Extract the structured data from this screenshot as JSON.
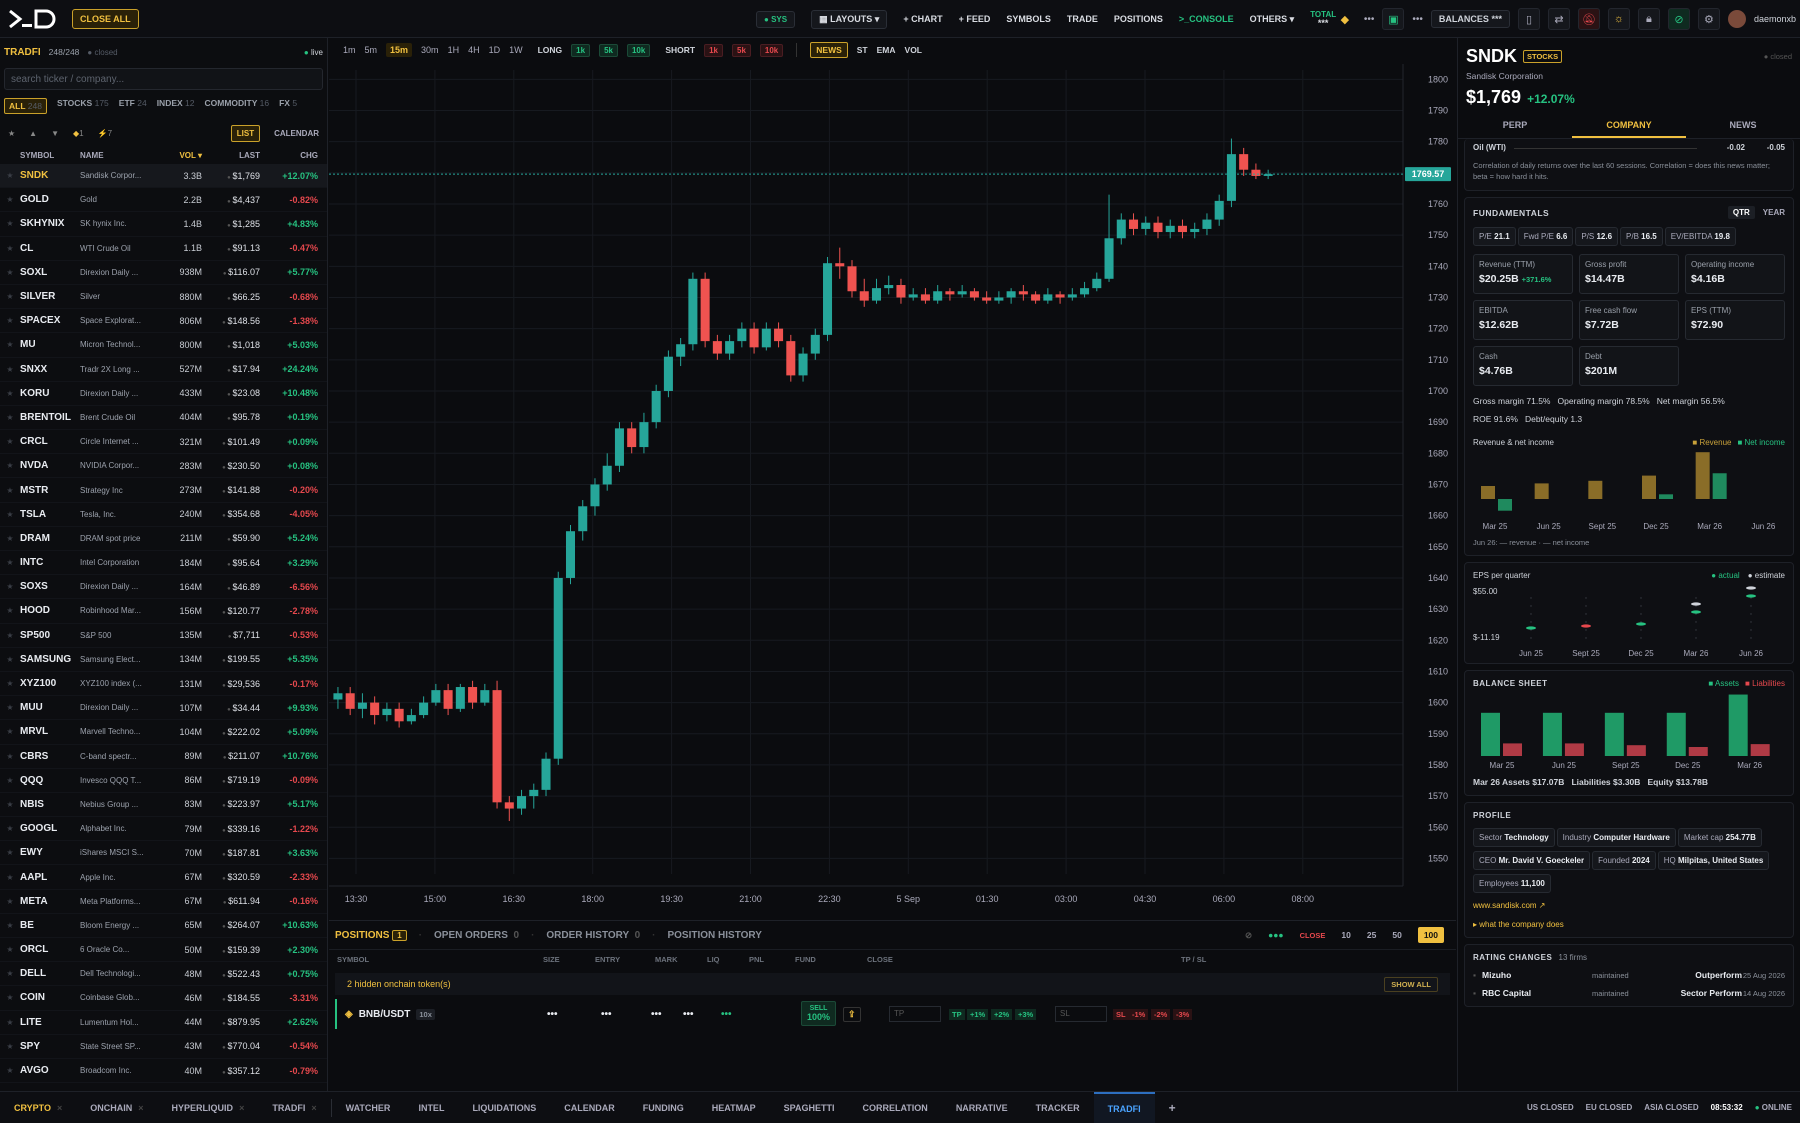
{
  "topbar": {
    "close_all": "CLOSE ALL",
    "sys": "SYS",
    "nav": [
      "LAYOUTS",
      "+ CHART",
      "+ FEED",
      "SYMBOLS",
      "TRADE",
      "POSITIONS",
      ">_CONSOLE",
      "OTHERS"
    ],
    "total_label": "TOTAL",
    "total_value": "***",
    "balances_label": "BALANCES",
    "balances_value": "***",
    "username": "daemonxb"
  },
  "watchlist": {
    "title": "TRADFI",
    "count": "248/248",
    "status_closed": "closed",
    "live": "live",
    "search_placeholder": "search ticker / company...",
    "categories": [
      {
        "label": "ALL",
        "n": "248"
      },
      {
        "label": "STOCKS",
        "n": "175"
      },
      {
        "label": "ETF",
        "n": "24"
      },
      {
        "label": "INDEX",
        "n": "12"
      },
      {
        "label": "COMMODITY",
        "n": "16"
      },
      {
        "label": "FX",
        "n": "5"
      }
    ],
    "filter_badges": [
      "1",
      "7"
    ],
    "list_btn": "LIST",
    "calendar_btn": "CALENDAR",
    "headers": {
      "symbol": "SYMBOL",
      "name": "NAME",
      "vol": "VOL",
      "last": "LAST",
      "chg": "CHG"
    },
    "rows": [
      [
        "SNDK",
        "Sandisk Corpor...",
        "3.3B",
        "$1,769",
        "+12.07%"
      ],
      [
        "GOLD",
        "Gold",
        "2.2B",
        "$4,437",
        "-0.82%"
      ],
      [
        "SKHYNIX",
        "SK hynix Inc.",
        "1.4B",
        "$1,285",
        "+4.83%"
      ],
      [
        "CL",
        "WTI Crude Oil",
        "1.1B",
        "$91.13",
        "-0.47%"
      ],
      [
        "SOXL",
        "Direxion Daily ...",
        "938M",
        "$116.07",
        "+5.77%"
      ],
      [
        "SILVER",
        "Silver",
        "880M",
        "$66.25",
        "-0.68%"
      ],
      [
        "SPACEX",
        "Space Explorat...",
        "806M",
        "$148.56",
        "-1.38%"
      ],
      [
        "MU",
        "Micron Technol...",
        "800M",
        "$1,018",
        "+5.03%"
      ],
      [
        "SNXX",
        "Tradr 2X Long ...",
        "527M",
        "$17.94",
        "+24.24%"
      ],
      [
        "KORU",
        "Direxion Daily ...",
        "433M",
        "$23.08",
        "+10.48%"
      ],
      [
        "BRENTOIL",
        "Brent Crude Oil",
        "404M",
        "$95.78",
        "+0.19%"
      ],
      [
        "CRCL",
        "Circle Internet ...",
        "321M",
        "$101.49",
        "+0.09%"
      ],
      [
        "NVDA",
        "NVIDIA Corpor...",
        "283M",
        "$230.50",
        "+0.08%"
      ],
      [
        "MSTR",
        "Strategy Inc",
        "273M",
        "$141.88",
        "-0.20%"
      ],
      [
        "TSLA",
        "Tesla, Inc.",
        "240M",
        "$354.68",
        "-4.05%"
      ],
      [
        "DRAM",
        "DRAM spot price",
        "211M",
        "$59.90",
        "+5.24%"
      ],
      [
        "INTC",
        "Intel Corporation",
        "184M",
        "$95.64",
        "+3.29%"
      ],
      [
        "SOXS",
        "Direxion Daily ...",
        "164M",
        "$46.89",
        "-6.56%"
      ],
      [
        "HOOD",
        "Robinhood Mar...",
        "156M",
        "$120.77",
        "-2.78%"
      ],
      [
        "SP500",
        "S&P 500",
        "135M",
        "$7,711",
        "-0.53%"
      ],
      [
        "SAMSUNG",
        "Samsung Elect...",
        "134M",
        "$199.55",
        "+5.35%"
      ],
      [
        "XYZ100",
        "XYZ100 index (...",
        "131M",
        "$29,536",
        "-0.17%"
      ],
      [
        "MUU",
        "Direxion Daily ...",
        "107M",
        "$34.44",
        "+9.93%"
      ],
      [
        "MRVL",
        "Marvell Techno...",
        "104M",
        "$222.02",
        "+5.09%"
      ],
      [
        "CBRS",
        "C-band spectr...",
        "89M",
        "$211.07",
        "+10.76%"
      ],
      [
        "QQQ",
        "Invesco QQQ T...",
        "86M",
        "$719.19",
        "-0.09%"
      ],
      [
        "NBIS",
        "Nebius Group ...",
        "83M",
        "$223.97",
        "+5.17%"
      ],
      [
        "GOOGL",
        "Alphabet Inc.",
        "79M",
        "$339.16",
        "-1.22%"
      ],
      [
        "EWY",
        "iShares MSCI S...",
        "70M",
        "$187.81",
        "+3.63%"
      ],
      [
        "AAPL",
        "Apple Inc.",
        "67M",
        "$320.59",
        "-2.33%"
      ],
      [
        "META",
        "Meta Platforms...",
        "67M",
        "$611.94",
        "-0.16%"
      ],
      [
        "BE",
        "Bloom Energy ...",
        "65M",
        "$264.07",
        "+10.63%"
      ],
      [
        "ORCL",
        "6 Oracle Co...",
        "50M",
        "$159.39",
        "+2.30%"
      ],
      [
        "DELL",
        "Dell Technologi...",
        "48M",
        "$522.43",
        "+0.75%"
      ],
      [
        "COIN",
        "Coinbase Glob...",
        "46M",
        "$184.55",
        "-3.31%"
      ],
      [
        "LITE",
        "Lumentum Hol...",
        "44M",
        "$879.95",
        "+2.62%"
      ],
      [
        "SPY",
        "State Street SP...",
        "43M",
        "$770.04",
        "-0.54%"
      ],
      [
        "AVGO",
        "Broadcom Inc.",
        "40M",
        "$357.12",
        "-0.79%"
      ]
    ]
  },
  "chart_toolbar": {
    "timeframes": [
      "1m",
      "5m",
      "15m",
      "30m",
      "1H",
      "4H",
      "1D",
      "1W"
    ],
    "active_tf": "15m",
    "long_label": "LONG",
    "long_sizes": [
      "1k",
      "5k",
      "10k"
    ],
    "short_label": "SHORT",
    "short_sizes": [
      "1k",
      "5k",
      "10k"
    ],
    "indicators": [
      "NEWS",
      "ST",
      "EMA",
      "VOL"
    ]
  },
  "chart_data": {
    "type": "candlestick",
    "y_ticks": [
      1800,
      1790,
      1780,
      1770,
      1760,
      1750,
      1740,
      1730,
      1720,
      1710,
      1700,
      1690,
      1680,
      1670,
      1660,
      1650,
      1640,
      1630,
      1620,
      1610,
      1600,
      1590,
      1580,
      1570,
      1560,
      1550
    ],
    "ylim": [
      1545,
      1803
    ],
    "x_ticks": [
      "13:30",
      "15:00",
      "16:30",
      "18:00",
      "19:30",
      "21:00",
      "22:30",
      "5 Sep",
      "01:30",
      "03:00",
      "04:30",
      "06:00",
      "08:00"
    ],
    "last_price": "1769.57",
    "last_value": 1769.57,
    "candles": [
      [
        1601,
        1603,
        1598,
        1605
      ],
      [
        1603,
        1598,
        1596,
        1605
      ],
      [
        1598,
        1600,
        1595,
        1603
      ],
      [
        1600,
        1596,
        1593,
        1602
      ],
      [
        1596,
        1598,
        1594,
        1600
      ],
      [
        1598,
        1594,
        1592,
        1600
      ],
      [
        1594,
        1596,
        1593,
        1598
      ],
      [
        1596,
        1600,
        1595,
        1602
      ],
      [
        1600,
        1604,
        1599,
        1606
      ],
      [
        1604,
        1598,
        1596,
        1606
      ],
      [
        1598,
        1605,
        1597,
        1606
      ],
      [
        1605,
        1600,
        1598,
        1607
      ],
      [
        1600,
        1604,
        1599,
        1606
      ],
      [
        1604,
        1568,
        1566,
        1607
      ],
      [
        1568,
        1566,
        1562,
        1570
      ],
      [
        1566,
        1570,
        1564,
        1572
      ],
      [
        1570,
        1572,
        1566,
        1574
      ],
      [
        1572,
        1582,
        1570,
        1584
      ],
      [
        1582,
        1640,
        1580,
        1642
      ],
      [
        1640,
        1655,
        1638,
        1657
      ],
      [
        1655,
        1663,
        1652,
        1665
      ],
      [
        1663,
        1670,
        1660,
        1672
      ],
      [
        1670,
        1676,
        1668,
        1680
      ],
      [
        1676,
        1688,
        1674,
        1690
      ],
      [
        1688,
        1682,
        1680,
        1690
      ],
      [
        1682,
        1690,
        1680,
        1693
      ],
      [
        1690,
        1700,
        1688,
        1702
      ],
      [
        1700,
        1711,
        1698,
        1713
      ],
      [
        1711,
        1715,
        1708,
        1717
      ],
      [
        1715,
        1736,
        1713,
        1738
      ],
      [
        1736,
        1716,
        1714,
        1738
      ],
      [
        1716,
        1712,
        1710,
        1718
      ],
      [
        1712,
        1716,
        1710,
        1718
      ],
      [
        1716,
        1720,
        1714,
        1722
      ],
      [
        1720,
        1714,
        1712,
        1722
      ],
      [
        1714,
        1720,
        1713,
        1722
      ],
      [
        1720,
        1716,
        1714,
        1722
      ],
      [
        1716,
        1705,
        1703,
        1718
      ],
      [
        1705,
        1712,
        1703,
        1714
      ],
      [
        1712,
        1718,
        1710,
        1720
      ],
      [
        1718,
        1741,
        1716,
        1743
      ],
      [
        1741,
        1740,
        1736,
        1746
      ],
      [
        1740,
        1732,
        1730,
        1742
      ],
      [
        1732,
        1729,
        1727,
        1736
      ],
      [
        1729,
        1733,
        1728,
        1736
      ],
      [
        1733,
        1734,
        1731,
        1737
      ],
      [
        1734,
        1730,
        1728,
        1736
      ],
      [
        1730,
        1731,
        1729,
        1733
      ],
      [
        1731,
        1729,
        1728,
        1733
      ],
      [
        1729,
        1732,
        1728,
        1734
      ],
      [
        1732,
        1731,
        1729,
        1733
      ],
      [
        1731,
        1732,
        1730,
        1734
      ],
      [
        1732,
        1730,
        1729,
        1733
      ],
      [
        1730,
        1729,
        1728,
        1732
      ],
      [
        1729,
        1730,
        1728,
        1732
      ],
      [
        1730,
        1732,
        1728,
        1733
      ],
      [
        1732,
        1731,
        1729,
        1734
      ],
      [
        1731,
        1729,
        1728,
        1732
      ],
      [
        1729,
        1731,
        1728,
        1733
      ],
      [
        1731,
        1730,
        1728,
        1732
      ],
      [
        1730,
        1731,
        1729,
        1733
      ],
      [
        1731,
        1733,
        1730,
        1735
      ],
      [
        1733,
        1736,
        1732,
        1738
      ],
      [
        1736,
        1749,
        1735,
        1763
      ],
      [
        1749,
        1755,
        1747,
        1757
      ],
      [
        1755,
        1752,
        1750,
        1757
      ],
      [
        1752,
        1754,
        1750,
        1756
      ],
      [
        1754,
        1751,
        1749,
        1756
      ],
      [
        1751,
        1753,
        1749,
        1755
      ],
      [
        1753,
        1751,
        1749,
        1755
      ],
      [
        1751,
        1752,
        1749,
        1754
      ],
      [
        1752,
        1755,
        1750,
        1757
      ],
      [
        1755,
        1761,
        1753,
        1763
      ],
      [
        1761,
        1776,
        1759,
        1781
      ],
      [
        1776,
        1771,
        1769,
        1778
      ],
      [
        1771,
        1769,
        1768,
        1773
      ],
      [
        1769,
        1769.57,
        1768,
        1771
      ]
    ]
  },
  "positions": {
    "tabs": [
      "POSITIONS",
      "OPEN ORDERS",
      "ORDER HISTORY",
      "POSITION HISTORY"
    ],
    "counts": [
      "1",
      "0",
      "0"
    ],
    "close_label": "CLOSE",
    "sizes": [
      "10",
      "25",
      "50",
      "100"
    ],
    "columns": [
      "SYMBOL",
      "SIZE",
      "ENTRY",
      "MARK",
      "LIQ",
      "PNL",
      "FUND",
      "CLOSE",
      "TP / SL"
    ],
    "hidden_note": "2 hidden onchain token(s)",
    "show_all": "SHOW ALL",
    "row": {
      "symbol": "BNB/USDT",
      "leverage": "10x",
      "sell": "SELL",
      "sell_pct": "100%",
      "tp_placeholder": "TP",
      "sl_placeholder": "SL",
      "tp_label": "TP",
      "sl_label": "SL",
      "tp_opts": [
        "+1%",
        "+2%",
        "+3%"
      ],
      "sl_opts": [
        "-1%",
        "-2%",
        "-3%"
      ]
    }
  },
  "detail": {
    "ticker": "SNDK",
    "tag": "STOCKS",
    "closed": "closed",
    "company": "Sandisk Corporation",
    "price": "$1,769",
    "change": "+12.07%",
    "tabs": [
      "PERP",
      "COMPANY",
      "NEWS"
    ],
    "corr_label": "Oil (WTI)",
    "corr_v1": "-0.02",
    "corr_v2": "-0.05",
    "corr_note": "Correlation of daily returns over the last 60 sessions. Correlation = does this news matter; beta = how hard it hits.",
    "fund_title": "FUNDAMENTALS",
    "qtr": "QTR",
    "year": "YEAR",
    "ratios": [
      [
        "P/E",
        "21.1"
      ],
      [
        "Fwd P/E",
        "6.6"
      ],
      [
        "P/S",
        "12.6"
      ],
      [
        "P/B",
        "16.5"
      ],
      [
        "EV/EBITDA",
        "19.8"
      ]
    ],
    "boxes": [
      [
        "Revenue (TTM)",
        "$20.25B",
        "+371.6%"
      ],
      [
        "Gross profit",
        "$14.47B",
        ""
      ],
      [
        "Operating income",
        "$4.16B",
        ""
      ],
      [
        "EBITDA",
        "$12.62B",
        ""
      ],
      [
        "Free cash flow",
        "$7.72B",
        ""
      ],
      [
        "EPS (TTM)",
        "$72.90",
        ""
      ],
      [
        "Cash",
        "$4.76B",
        ""
      ],
      [
        "Debt",
        "$201M",
        ""
      ]
    ],
    "margins": "Gross margin 71.5%   Operating margin 78.5%   Net margin 56.5%",
    "roe": "ROE 91.6%   Debt/equity 1.3",
    "rev_title": "Revenue & net income",
    "rev_legend": [
      "Revenue",
      "Net income"
    ],
    "rev_quarters": [
      "Mar 25",
      "Jun 25",
      "Sept 25",
      "Dec 25",
      "Mar 26",
      "Jun 26"
    ],
    "rev_note": "Jun 26: — revenue · — net income",
    "rev_values": [
      [
        10,
        -10
      ],
      [
        12,
        0
      ],
      [
        14,
        0
      ],
      [
        18,
        4
      ],
      [
        36,
        22
      ],
      [
        0,
        0
      ]
    ],
    "eps_title": "EPS per quarter",
    "eps_legend": [
      "actual",
      "estimate"
    ],
    "eps_top": "$55.00",
    "eps_bottom": "$-11.19",
    "eps_quarters": [
      "Jun 25",
      "Sept 25",
      "Dec 25",
      "Mar 26",
      "Jun 26"
    ],
    "bs_title": "BALANCE SHEET",
    "bs_legend": [
      "Assets",
      "Liabilities"
    ],
    "bs_quarters": [
      "Mar 25",
      "Jun 25",
      "Sept 25",
      "Dec 25",
      "Mar 26"
    ],
    "bs_values": [
      [
        12,
        3.5
      ],
      [
        12,
        3.5
      ],
      [
        12,
        3
      ],
      [
        12,
        2.5
      ],
      [
        17.07,
        3.3
      ]
    ],
    "bs_note": "Mar 26 Assets $17.07B   Liabilities $3.30B   Equity $13.78B",
    "profile_title": "PROFILE",
    "profile_chips": [
      [
        "Sector",
        "Technology"
      ],
      [
        "Industry",
        "Computer Hardware"
      ],
      [
        "Market cap",
        "254.77B"
      ],
      [
        "CEO",
        "Mr. David V. Goeckeler"
      ],
      [
        "Founded",
        "2024"
      ],
      [
        "HQ",
        "Milpitas, United States"
      ],
      [
        "Employees",
        "11,100"
      ]
    ],
    "website": "www.sandisk.com ↗",
    "what_does": "▸ what the company does",
    "ratings_title": "RATING CHANGES",
    "ratings_count": "13 firms",
    "ratings": [
      [
        "Mizuho",
        "maintained",
        "Outperform",
        "25 Aug 2026"
      ],
      [
        "RBC Capital",
        "maintained",
        "Sector Perform",
        "14 Aug 2026"
      ]
    ]
  },
  "bottombar": {
    "tabs": [
      "CRYPTO",
      "ONCHAIN",
      "HYPERLIQUID",
      "TRADFI",
      "WATCHER",
      "INTEL",
      "LIQUIDATIONS",
      "CALENDAR",
      "FUNDING",
      "HEATMAP",
      "SPAGHETTI",
      "CORRELATION",
      "NARRATIVE",
      "TRACKER",
      "TRADFI"
    ],
    "markets": [
      "US CLOSED",
      "EU CLOSED",
      "ASIA CLOSED"
    ],
    "clock": "08:53:32",
    "online": "ONLINE"
  },
  "colors": {
    "accent": "#f0c040",
    "up": "#26c281",
    "down": "#e5484d"
  }
}
